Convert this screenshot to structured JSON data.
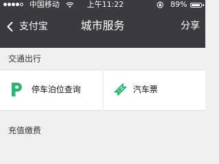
{
  "status_bar": {
    "carrier": "中国移动",
    "time": "上午11:22",
    "battery_percent": "89%",
    "battery_level": 0.89,
    "signal_bars_filled": 4,
    "signal_bars_total": 5,
    "icons": [
      "signal-icon",
      "wifi-icon",
      "orientation-lock-icon",
      "battery-icon"
    ]
  },
  "nav": {
    "back_label": "支付宝",
    "title": "城市服务",
    "share_label": "分享",
    "icons": [
      "chevron-left-icon"
    ]
  },
  "sections": [
    {
      "title": "交通出行",
      "items": [
        {
          "label": "停车泊位查询",
          "icon": "parking-icon",
          "icon_color": "#2bb673"
        },
        {
          "label": "汽车票",
          "icon": "ticket-icon",
          "icon_color": "#2bb673"
        }
      ]
    },
    {
      "title": "充值缴费",
      "items": []
    }
  ],
  "colors": {
    "nav_background": "#3a3b3e",
    "page_background": "#f0f0f3",
    "accent_green": "#2bb673"
  }
}
